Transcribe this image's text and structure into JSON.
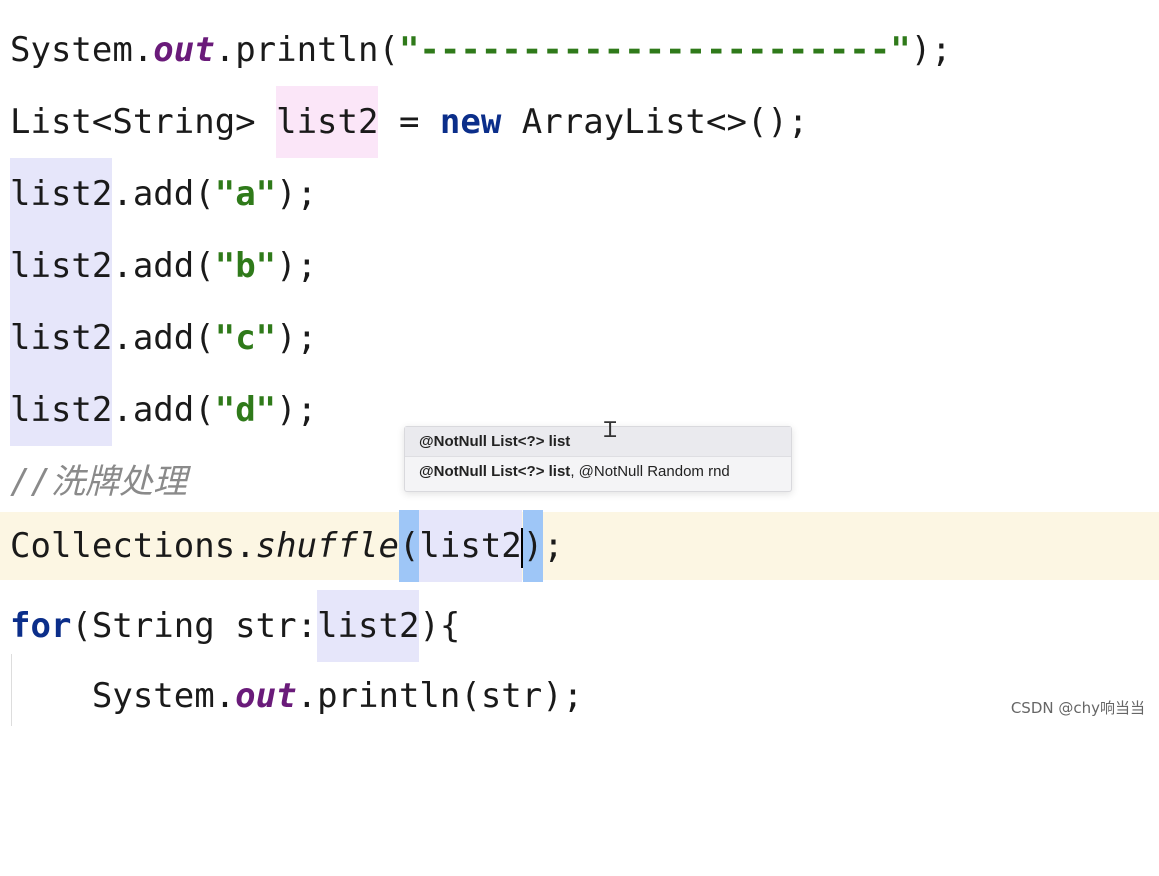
{
  "code": {
    "line1": {
      "a": "System.",
      "b": "out",
      "c": ".println(",
      "d": "\"-----------------------\"",
      "e": ");"
    },
    "line2": {
      "a": "List<String> ",
      "b": "list2",
      "c": " = ",
      "d": "new",
      "e": " ArrayList<>();"
    },
    "line3": {
      "a": "list2",
      "b": ".add(",
      "c": "\"a\"",
      "d": ");"
    },
    "line4": {
      "a": "list2",
      "b": ".add(",
      "c": "\"b\"",
      "d": ");"
    },
    "line5": {
      "a": "list2",
      "b": ".add(",
      "c": "\"c\"",
      "d": ");"
    },
    "line6": {
      "a": "list2",
      "b": ".add(",
      "c": "\"d\"",
      "d": ");"
    },
    "line7": {
      "a": "//洗牌处理"
    },
    "line8": {
      "a": "Collections.",
      "b": "shuffle",
      "c": "(",
      "d": "list2",
      "e": ")",
      "f": ";"
    },
    "line9": {
      "a": "for",
      "b": "(String str:",
      "c": "list2",
      "d": "){"
    },
    "line10": {
      "a": "    System.",
      "b": "out",
      "c": ".println(str);"
    }
  },
  "popup": {
    "row1": {
      "a": "@NotNull List<?> list"
    },
    "row2": {
      "a": "@NotNull List<?> list",
      "b": ", @NotNull Random rnd"
    }
  },
  "watermark": "CSDN @chy响当当"
}
